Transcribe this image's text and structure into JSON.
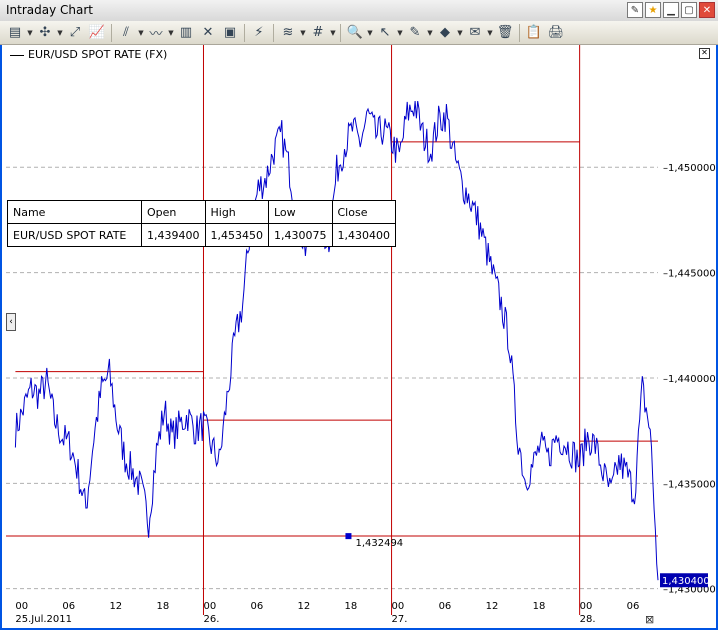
{
  "window": {
    "title": "Intraday Chart"
  },
  "legend": {
    "label": "EUR/USD SPOT RATE (FX)"
  },
  "table": {
    "headers": [
      "Name",
      "Open",
      "High",
      "Low",
      "Close"
    ],
    "row": [
      "EUR/USD SPOT RATE",
      "1,439400",
      "1,453450",
      "1,430075",
      "1,430400"
    ]
  },
  "marker_label": "1,432494",
  "last_price": "1,430400",
  "colors": {
    "series": "#0000cc",
    "grid": "#b0b0b0",
    "session": "#c00000",
    "window": "#0054e3"
  },
  "toolbar_icons": [
    "new-chart-icon",
    "crosshair-icon",
    "zoom-chart-icon",
    "line-chart-icon",
    "indicator-icon",
    "trend-icon",
    "bar-chart-icon",
    "compare-icon",
    "template-icon",
    "tools-icon",
    "layout-icon",
    "grid-icon",
    "search-icon",
    "cursor-icon",
    "pen-icon",
    "layer-icon",
    "annotation-icon",
    "delete-icon",
    "copy-icon",
    "print-icon"
  ],
  "chart_data": {
    "type": "line",
    "series": [
      {
        "name": "EUR/USD SPOT RATE (FX)"
      }
    ],
    "ylim": [
      1.4297,
      1.4558
    ],
    "y_ticks": [
      "1,450000",
      "1,445000",
      "1,440000",
      "1,435000",
      "1,430000"
    ],
    "y_tick_values": [
      1.45,
      1.445,
      1.44,
      1.435,
      1.43
    ],
    "x_ticks": [
      "00",
      "06",
      "12",
      "18",
      "00",
      "06",
      "12",
      "18",
      "00",
      "06",
      "12",
      "18",
      "00",
      "06"
    ],
    "date_labels": [
      "25.Jul.2011",
      "26.",
      "27.",
      "28."
    ],
    "x_hours": [
      0,
      6,
      12,
      18,
      24,
      30,
      36,
      42,
      48,
      54,
      60,
      66,
      72,
      78
    ],
    "xlim": [
      -1.2,
      82
    ],
    "session_levels": [
      {
        "from_hour": 0,
        "to_hour": 24,
        "value": 1.4403
      },
      {
        "from_hour": 24,
        "to_hour": 48,
        "value": 1.438
      },
      {
        "from_hour": 48,
        "to_hour": 72,
        "value": 1.4512
      },
      {
        "from_hour": 72,
        "to_hour": 82,
        "value": 1.437
      },
      {
        "from_hour": -1.2,
        "to_hour": 82,
        "value": 1.4325
      }
    ],
    "marker": {
      "hour": 42.5,
      "value": 1.432494
    },
    "points": [
      [
        0,
        1.4375
      ],
      [
        1,
        1.4385
      ],
      [
        2,
        1.4395
      ],
      [
        3,
        1.4392
      ],
      [
        4,
        1.4398
      ],
      [
        5,
        1.438
      ],
      [
        6,
        1.4372
      ],
      [
        7,
        1.4368
      ],
      [
        8,
        1.4355
      ],
      [
        9,
        1.4338
      ],
      [
        10,
        1.4372
      ],
      [
        11,
        1.4395
      ],
      [
        12,
        1.4402
      ],
      [
        13,
        1.4378
      ],
      [
        14,
        1.4362
      ],
      [
        15,
        1.4355
      ],
      [
        16,
        1.4348
      ],
      [
        17,
        1.4332
      ],
      [
        18,
        1.4365
      ],
      [
        19,
        1.4385
      ],
      [
        20,
        1.4372
      ],
      [
        21,
        1.4378
      ],
      [
        22,
        1.4382
      ],
      [
        23,
        1.4375
      ],
      [
        24,
        1.4378
      ],
      [
        25,
        1.4368
      ],
      [
        26,
        1.436
      ],
      [
        27,
        1.439
      ],
      [
        28,
        1.4418
      ],
      [
        29,
        1.4435
      ],
      [
        30,
        1.4472
      ],
      [
        31,
        1.449
      ],
      [
        32,
        1.4495
      ],
      [
        33,
        1.4508
      ],
      [
        34,
        1.4515
      ],
      [
        35,
        1.4498
      ],
      [
        36,
        1.4475
      ],
      [
        37,
        1.4462
      ],
      [
        38,
        1.4482
      ],
      [
        39,
        1.447
      ],
      [
        40,
        1.4465
      ],
      [
        41,
        1.4498
      ],
      [
        42,
        1.451
      ],
      [
        43,
        1.4518
      ],
      [
        44,
        1.4512
      ],
      [
        45,
        1.4525
      ],
      [
        46,
        1.4515
      ],
      [
        47,
        1.4518
      ],
      [
        48,
        1.4512
      ],
      [
        49,
        1.4505
      ],
      [
        50,
        1.4525
      ],
      [
        51,
        1.453
      ],
      [
        52,
        1.4515
      ],
      [
        53,
        1.4508
      ],
      [
        54,
        1.4522
      ],
      [
        55,
        1.4525
      ],
      [
        56,
        1.4505
      ],
      [
        57,
        1.4492
      ],
      [
        58,
        1.4485
      ],
      [
        59,
        1.4475
      ],
      [
        60,
        1.4462
      ],
      [
        61,
        1.4448
      ],
      [
        62,
        1.4435
      ],
      [
        63,
        1.4418
      ],
      [
        64,
        1.4375
      ],
      [
        65,
        1.4352
      ],
      [
        66,
        1.4358
      ],
      [
        67,
        1.4368
      ],
      [
        68,
        1.4362
      ],
      [
        69,
        1.4372
      ],
      [
        70,
        1.437
      ],
      [
        71,
        1.4365
      ],
      [
        72,
        1.436
      ],
      [
        73,
        1.4372
      ],
      [
        74,
        1.4368
      ],
      [
        75,
        1.4355
      ],
      [
        76,
        1.4345
      ],
      [
        77,
        1.436
      ],
      [
        78,
        1.4355
      ],
      [
        79,
        1.4345
      ],
      [
        80,
        1.4395
      ],
      [
        81,
        1.4375
      ],
      [
        82,
        1.4304
      ]
    ]
  }
}
